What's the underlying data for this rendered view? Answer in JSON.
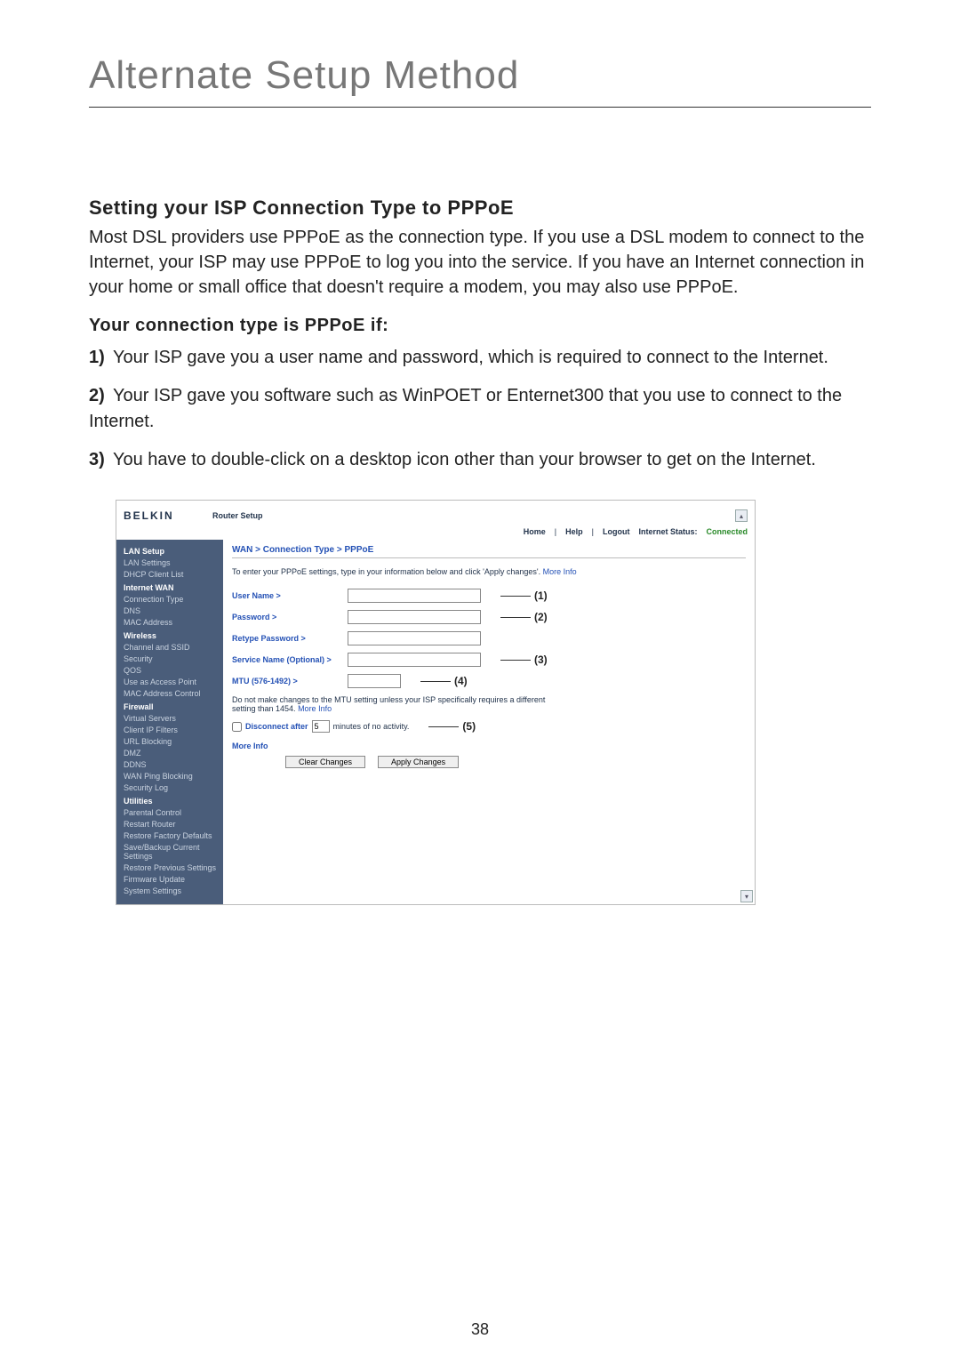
{
  "page": {
    "title": "Alternate Setup Method",
    "section_heading": "Setting your ISP Connection Type to PPPoE",
    "section_body": "Most DSL providers use PPPoE as the connection type. If you use a DSL modem to connect to the Internet, your ISP may use PPPoE to log you into the service. If you have an Internet connection in your home or small office that doesn't require a modem, you may also use PPPoE.",
    "sub_heading": "Your connection type is PPPoE if:",
    "list": [
      {
        "num": "1)",
        "text": " Your ISP gave you a user name and password, which is required to connect to the Internet."
      },
      {
        "num": "2)",
        "text": " Your ISP gave you software such as WinPOET or Enternet300 that you use to connect to the Internet."
      },
      {
        "num": "3)",
        "text": " You have to double-click on a desktop icon other than your browser to get on the Internet."
      }
    ],
    "page_number": "38"
  },
  "router": {
    "brand": "BELKIN",
    "header_title": "Router Setup",
    "nav": {
      "home": "Home",
      "help": "Help",
      "logout": "Logout",
      "status_label": "Internet Status:",
      "status_value": "Connected"
    },
    "sidebar": {
      "groups": [
        {
          "cat": "LAN Setup",
          "items": [
            "LAN Settings",
            "DHCP Client List"
          ]
        },
        {
          "cat": "Internet WAN",
          "items": [
            "Connection Type",
            "DNS",
            "MAC Address"
          ]
        },
        {
          "cat": "Wireless",
          "items": [
            "Channel and SSID",
            "Security",
            "QOS",
            "Use as Access Point",
            "MAC Address Control"
          ]
        },
        {
          "cat": "Firewall",
          "items": [
            "Virtual Servers",
            "Client IP Filters",
            "URL Blocking",
            "DMZ",
            "DDNS",
            "WAN Ping Blocking",
            "Security Log"
          ]
        },
        {
          "cat": "Utilities",
          "items": [
            "Parental Control",
            "Restart Router",
            "Restore Factory Defaults",
            "Save/Backup Current Settings",
            "Restore Previous Settings",
            "Firmware Update",
            "System Settings"
          ]
        }
      ]
    },
    "breadcrumb": "WAN > Connection Type > PPPoE",
    "info_line_pre": "To enter your PPPoE settings, type in your information below and click 'Apply changes'. ",
    "info_line_link": "More Info",
    "form": {
      "username_label": "User Name >",
      "password_label": "Password >",
      "retype_label": "Retype Password >",
      "service_label": "Service Name (Optional) >",
      "mtu_label": "MTU (576-1492) >",
      "mtu_note_pre": "Do not make changes to the MTU setting unless your ISP specifically requires a different setting than 1454. ",
      "mtu_note_link": "More Info",
      "disconnect_label": "Disconnect after ",
      "disconnect_value": "5",
      "disconnect_suffix": " minutes of no activity.",
      "more_info": "More Info",
      "clear_btn": "Clear Changes",
      "apply_btn": "Apply Changes"
    },
    "callouts": {
      "c1": "(1)",
      "c2": "(2)",
      "c3": "(3)",
      "c4": "(4)",
      "c5": "(5)"
    }
  }
}
